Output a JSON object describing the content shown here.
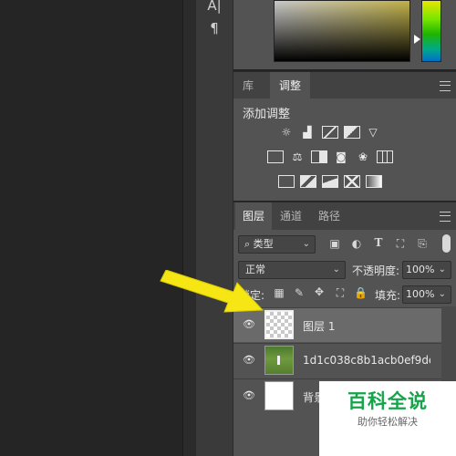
{
  "tools": {
    "char_a": "A|",
    "pilcrow": "¶"
  },
  "top_panel_tabs": [
    {
      "label": "库"
    },
    {
      "label": "调整"
    }
  ],
  "adjustments": {
    "title": "添加调整",
    "icons": [
      "brightness-contrast-icon",
      "levels-icon",
      "curves-icon",
      "exposure-icon",
      "vibrance-icon",
      "hue-saturation-icon",
      "color-balance-icon",
      "black-white-icon",
      "photo-filter-icon",
      "channel-mixer-icon",
      "color-lookup-icon",
      "invert-icon",
      "posterize-icon",
      "threshold-icon",
      "selective-color-icon",
      "gradient-map-icon"
    ]
  },
  "layers_panel": {
    "tabs": [
      {
        "label": "图层"
      },
      {
        "label": "通道"
      },
      {
        "label": "路径"
      }
    ],
    "filter_kind": "类型",
    "blend_mode": "正常",
    "opacity_label": "不透明度:",
    "opacity_value": "100%",
    "lock_label": "锁定:",
    "fill_label": "填充:",
    "fill_value": "100%",
    "layers": [
      {
        "name": "图层 1",
        "selected": true,
        "visible": true,
        "thumb": "transparent"
      },
      {
        "name": "1d1c038c8b1acb0ef9de6...",
        "selected": false,
        "visible": true,
        "thumb": "photo"
      },
      {
        "name": "背景",
        "selected": false,
        "visible": true,
        "thumb": "white"
      }
    ]
  },
  "watermark": {
    "title": "百科全说",
    "subtitle": "助你轻松解决"
  },
  "colors": {
    "annotation_arrow": "#f5e614",
    "panel_bg": "#535353",
    "selected_row": "#6a6a6a",
    "watermark_green": "#16a34a"
  }
}
